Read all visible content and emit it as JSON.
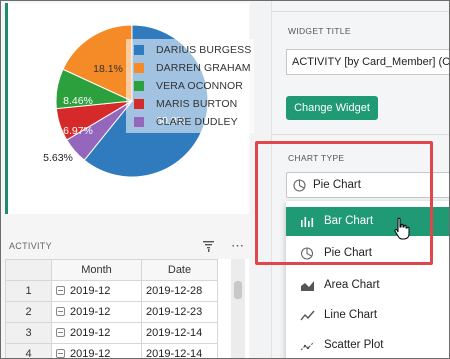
{
  "pie": {
    "legend": [
      {
        "name": "DARIUS BURGESS",
        "color": "#2f7bbd"
      },
      {
        "name": "DARREN GRAHAM",
        "color": "#f58b26"
      },
      {
        "name": "VERA OCONNOR",
        "color": "#2ca03c"
      },
      {
        "name": "MARIS BURTON",
        "color": "#d62a2a"
      },
      {
        "name": "CLARE DUDLEY",
        "color": "#9467bd"
      }
    ],
    "labels": {
      "graham": "18.1%",
      "oconnor": "8.46%",
      "burton": "6.97%",
      "dudley": "5.63%",
      "burgess": "60.8%"
    }
  },
  "activity": {
    "title": "ACTIVITY",
    "columns": {
      "month": "Month",
      "date": "Date"
    },
    "rows": [
      {
        "num": "1",
        "month": "2019-12",
        "date": "2019-12-28"
      },
      {
        "num": "2",
        "month": "2019-12",
        "date": "2019-12-23"
      },
      {
        "num": "3",
        "month": "2019-12",
        "date": "2019-12-14"
      },
      {
        "num": "4",
        "month": "2019-12",
        "date": "2019-12-14"
      }
    ]
  },
  "config": {
    "widget_title_label": "WIDGET TITLE",
    "widget_title_value": "ACTIVITY [by Card_Member] (C",
    "change_widget_label": "Change Widget",
    "chart_type_label": "CHART TYPE",
    "chart_type_selected": "Pie Chart",
    "options": [
      "Bar Chart",
      "Pie Chart",
      "Area Chart",
      "Line Chart",
      "Scatter Plot"
    ]
  },
  "colors": {
    "accent": "#1f9a74",
    "highlight": "#e0474c"
  }
}
